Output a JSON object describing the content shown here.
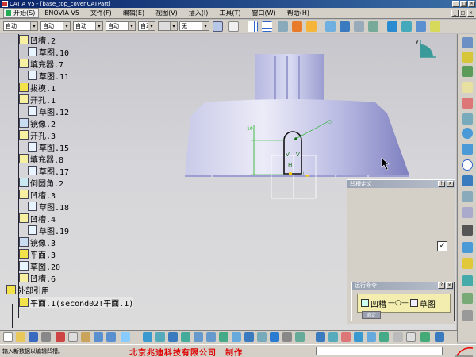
{
  "window": {
    "title": "CATIA V5 - [base_top_cover.CATPart]",
    "buttons": [
      "_",
      "□",
      "×"
    ]
  },
  "menu": {
    "items": [
      "开始(S)",
      "ENOVIA V5",
      "文件(F)",
      "编辑(E)",
      "视图(V)",
      "插入(I)",
      "工具(T)",
      "窗口(W)",
      "帮助(H)"
    ],
    "mdi_buttons": [
      "_",
      "□",
      "×"
    ]
  },
  "toolbar_top": {
    "combos": [
      "自动",
      "自动",
      "自动",
      "自动",
      "自动",
      "无"
    ]
  },
  "tree": {
    "items": [
      {
        "label": "凹槽.2",
        "icon": "pocket-icon",
        "color": "#f6f0a0"
      },
      {
        "label": "草图.10",
        "icon": "sketch-icon",
        "color": "#e8f4ff"
      },
      {
        "label": "填充器.7",
        "icon": "pad-icon",
        "color": "#f6f0a0"
      },
      {
        "label": "草图.11",
        "icon": "sketch-icon",
        "color": "#e8f4ff"
      },
      {
        "label": "拔模.1",
        "icon": "draft-icon",
        "color": "#f3e24a"
      },
      {
        "label": "开孔.1",
        "icon": "hole-icon",
        "color": "#f6f0a0"
      },
      {
        "label": "草图.12",
        "icon": "sketch-icon",
        "color": "#e8f4ff"
      },
      {
        "label": "镜像.2",
        "icon": "mirror-icon",
        "color": "#c9dcf2"
      },
      {
        "label": "开孔.3",
        "icon": "hole-icon",
        "color": "#f6f0a0"
      },
      {
        "label": "草图.15",
        "icon": "sketch-icon",
        "color": "#e8f4ff"
      },
      {
        "label": "填充器.8",
        "icon": "pad-icon",
        "color": "#f6f0a0"
      },
      {
        "label": "草图.17",
        "icon": "sketch-icon",
        "color": "#e8f4ff"
      },
      {
        "label": "倒圆角.2",
        "icon": "fillet-icon",
        "color": "#c9e8f2"
      },
      {
        "label": "凹槽.3",
        "icon": "pocket-icon",
        "color": "#f6f0a0"
      },
      {
        "label": "草图.18",
        "icon": "sketch-icon",
        "color": "#e8f4ff"
      },
      {
        "label": "凹槽.4",
        "icon": "pocket-icon",
        "color": "#f6f0a0"
      },
      {
        "label": "草图.19",
        "icon": "sketch-icon",
        "color": "#e8f4ff"
      },
      {
        "label": "镜像.3",
        "icon": "mirror-icon",
        "color": "#c9dcf2"
      },
      {
        "label": "平面.3",
        "icon": "plane-icon",
        "color": "#f3e24a"
      },
      {
        "label": "草图.20",
        "icon": "sketch-icon",
        "color": "#e8f4ff"
      },
      {
        "label": "凹槽.6",
        "icon": "pocket-icon",
        "color": "#f6f0a0"
      },
      {
        "label": "外部引用",
        "icon": "external-ref-icon",
        "color": "#f3e24a"
      },
      {
        "label": "平面.1(second02!平面.1)",
        "icon": "plane-icon",
        "color": "#f3e24a"
      }
    ]
  },
  "sketch": {
    "dimension": "10"
  },
  "dialog": {
    "title": "凹槽定义",
    "help_button": "?",
    "close_button": "×",
    "check_symbol": "✓"
  },
  "run_command": {
    "title": "运行命令",
    "help_button": "?",
    "close_button": "×",
    "item1": "凹槽",
    "item2": "草图",
    "ok_button": "确定"
  },
  "status": {
    "prompt": "输入新数据以编辑凹槽。",
    "company": "北京兆迪科技有限公司　制作"
  },
  "colors": {
    "model": "#a7a8d8",
    "sketch_green": "#19b419",
    "title_blue": "#0a246a",
    "company_red": "#e00000"
  }
}
